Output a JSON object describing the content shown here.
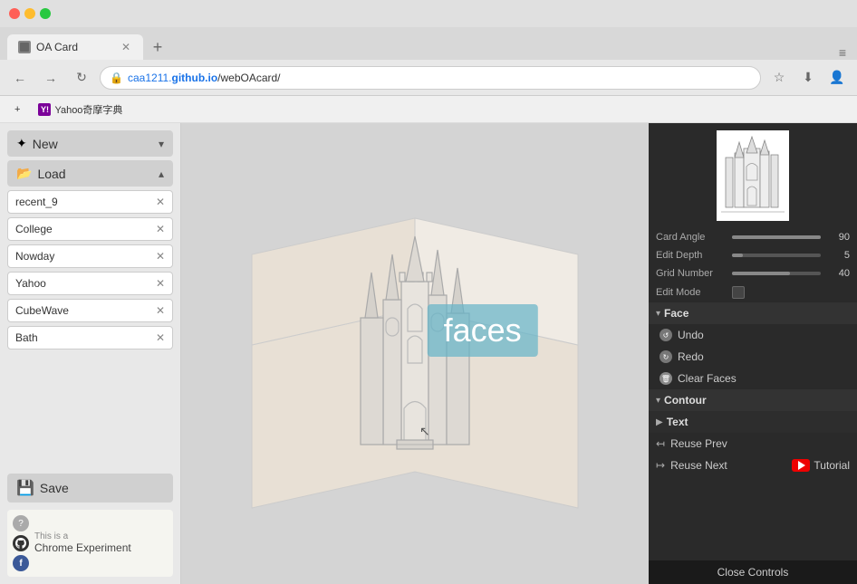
{
  "browser": {
    "tab_title": "OA Card",
    "url": "caa1211.github.io/webOAcard/",
    "url_display": "caa1211.github.io/webOAcard/",
    "new_tab_label": "+",
    "bookmarks": [
      {
        "label": "Yahoo奇摩字典",
        "id": "yahoo-bookmark"
      }
    ]
  },
  "left_panel": {
    "new_label": "New",
    "new_arrow": "▾",
    "load_label": "Load",
    "load_arrow": "▴",
    "saved_items": [
      {
        "name": "recent_9",
        "id": "item-recent9"
      },
      {
        "name": "College",
        "id": "item-college"
      },
      {
        "name": "Nowday",
        "id": "item-nowday"
      },
      {
        "name": "Yahoo",
        "id": "item-yahoo"
      },
      {
        "name": "CubeWave",
        "id": "item-cubewave"
      },
      {
        "name": "Bath",
        "id": "item-bath"
      }
    ],
    "save_label": "Save",
    "save_icon": "💾"
  },
  "canvas": {
    "faces_label": "faces"
  },
  "right_panel": {
    "properties": {
      "card_angle_label": "Card Angle",
      "card_angle_value": "90",
      "card_angle_pct": 100,
      "edit_depth_label": "Edit Depth",
      "edit_depth_value": "5",
      "edit_depth_pct": 12,
      "grid_number_label": "Grid Number",
      "grid_number_value": "40",
      "grid_number_pct": 65,
      "edit_mode_label": "Edit Mode"
    },
    "face_section": {
      "title": "Face",
      "undo_label": "Undo",
      "redo_label": "Redo",
      "clear_faces_label": "Clear Faces"
    },
    "contour_section": {
      "title": "Contour"
    },
    "text_section": {
      "title": "Text"
    },
    "reuse_prev_label": "Reuse Prev",
    "reuse_next_label": "Reuse Next",
    "tutorial_label": "Tutorial",
    "close_controls_label": "Close Controls"
  },
  "chrome_experiment": {
    "this_is_a": "This is a",
    "title": "Chrome Experiment",
    "help_icon": "?",
    "github_icon": "gh",
    "facebook_icon": "f"
  }
}
